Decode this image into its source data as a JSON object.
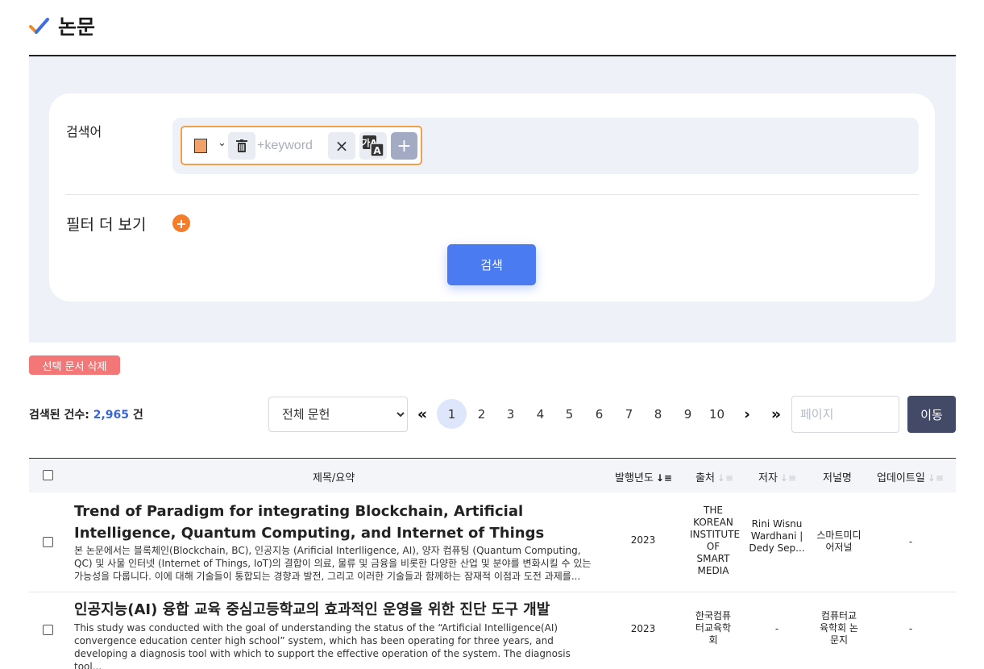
{
  "header": {
    "title": "논문"
  },
  "search": {
    "keyword_label": "검색어",
    "keyword_placeholder": "+keyword",
    "translate_label": "가A",
    "filter_more_label": "필터 더 보기",
    "filter_more_icon": "+",
    "search_button": "검색"
  },
  "actions": {
    "delete_selected": "선택 문서 삭제"
  },
  "results": {
    "count_label": "검색된 건수: ",
    "count_value": "2,965",
    "count_unit": " 건"
  },
  "doc_filter": {
    "selected": "전체 문헌",
    "options": [
      "전체 문헌"
    ]
  },
  "pagination": {
    "first": "«",
    "pages": [
      "1",
      "2",
      "3",
      "4",
      "5",
      "6",
      "7",
      "8",
      "9",
      "10"
    ],
    "current": "1",
    "next": "›",
    "last": "»",
    "page_input_placeholder": "페이지",
    "go_button": "이동"
  },
  "table": {
    "headers": {
      "title": "제목/요약",
      "year": "발행년도",
      "source": "출처",
      "author": "저자",
      "journal": "저널명",
      "updated": "업데이트일"
    },
    "rows": [
      {
        "title": "Trend of Paradigm for integrating Blockchain, Artificial Intelligence, Quantum Computing, and Internet of Things",
        "abstract": "본 논문에서는 블록체인(Blockchain, BC), 인공지능 (Arificial Interlligence, AI), 양자 컴퓨팅 (Quantum Computing, QC) 및 사물 인터넷 (Internet of Things, IoT)의 결합이 의료, 물류 및 금융을 비롯한 다양한 산업 및 분야를 변화시킬 수 있는 가능성을 다룹니다. 이에 대해 기술들이 통합되는 경향과 발전, 그리고 이러한 기술들과 함께하는 잠재적 이점과 도전 과제를...",
        "year": "2023",
        "source": "THE KOREAN INSTITUTE OF SMART MEDIA",
        "author": "Rini Wisnu Wardhani | Dedy Sep...",
        "journal": "스마트미디어저널",
        "updated": "-"
      },
      {
        "title": "인공지능(AI) 융합 교육 중심고등학교의 효과적인 운영을 위한 진단 도구 개발",
        "abstract": "This study was conducted with the goal of understanding the status of the “Artificial Intelligence(AI) convergence education center high school” system, which has been operating for three years, and developing a diagnosis tool with which to support the effective operation of the system. The diagnosis tool...",
        "year": "2023",
        "source": "한국컴퓨터교육학회",
        "author": "-",
        "journal": "컴퓨터교육학회 논문지",
        "updated": "-"
      }
    ]
  },
  "colors": {
    "accent": "#4a7bf0",
    "keyword_border": "#f0a04b",
    "keyword_swatch": "#f0a26a",
    "filter_button": "#f37d2b",
    "delete_badge": "#f47777",
    "go_button": "#434a68",
    "panel_bg": "#eef1f7",
    "check_orange": "#f08a24",
    "check_blue": "#3f6fe0"
  },
  "icons": [
    "check-icon",
    "chevron-down-icon",
    "trash-icon",
    "close-icon",
    "translate-icon",
    "plus-icon",
    "sort-icon"
  ]
}
